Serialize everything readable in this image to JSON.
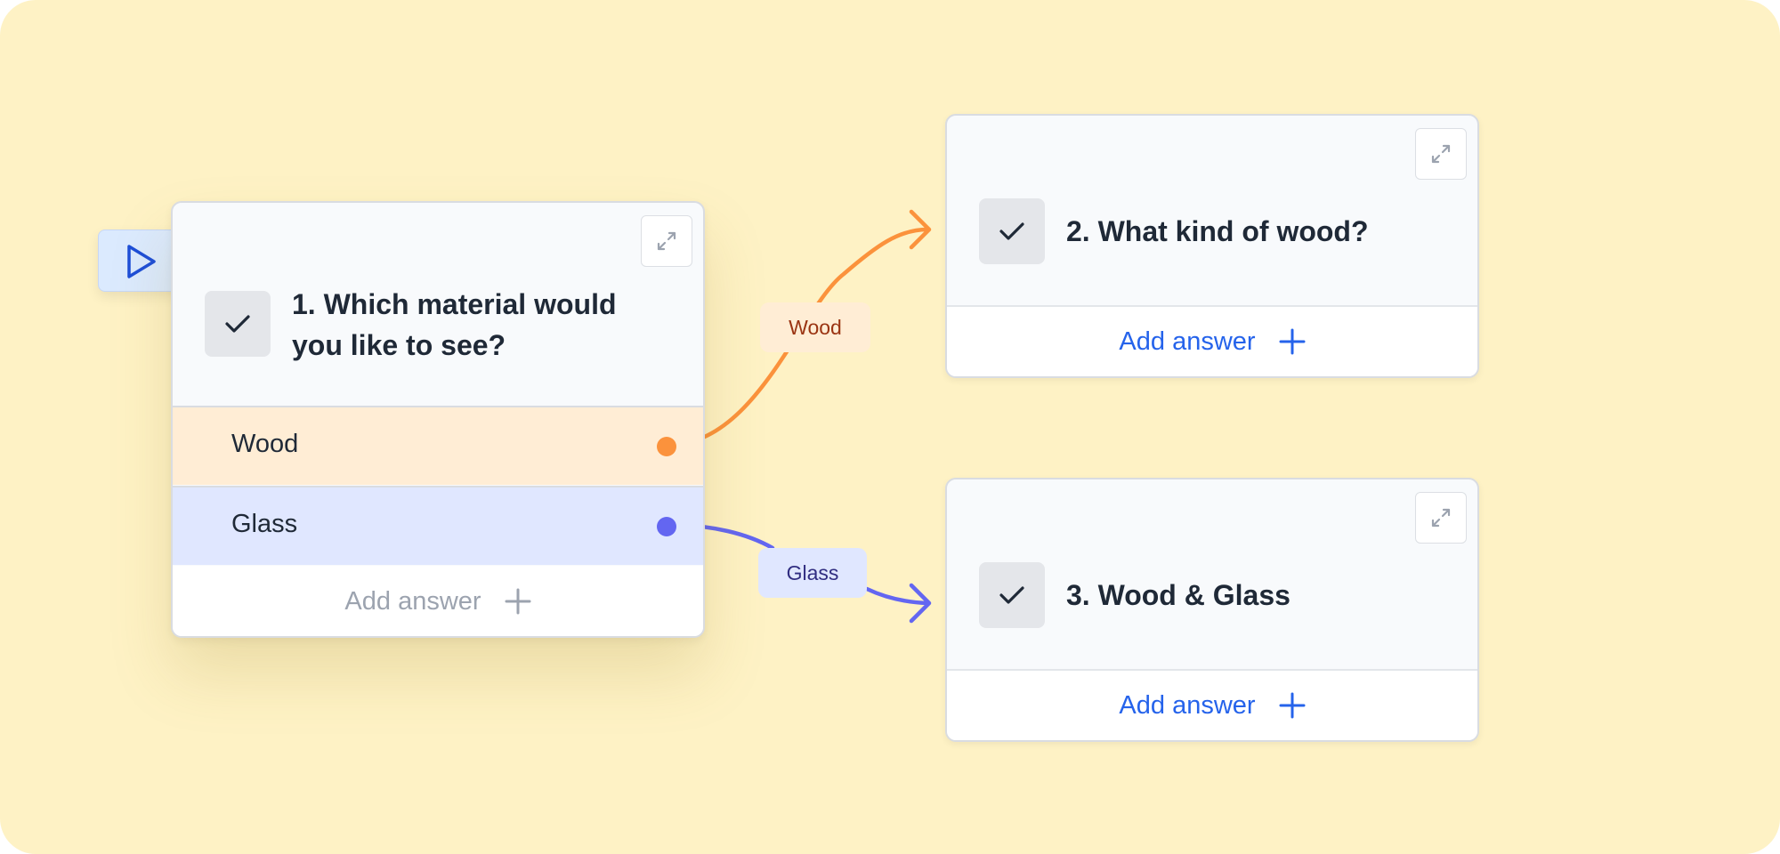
{
  "colors": {
    "background": "#fef2c5",
    "wood_path": "#fb923c",
    "glass_path": "#6366f1",
    "accent_blue": "#2563eb"
  },
  "questions": [
    {
      "title": "1. Which material would you like to see?",
      "answers": [
        "Wood",
        "Glass"
      ],
      "add_answer_label": "Add answer"
    },
    {
      "title": "2. What kind of wood?",
      "add_answer_label": "Add answer"
    },
    {
      "title": "3. Wood & Glass",
      "add_answer_label": "Add answer"
    }
  ],
  "connections": [
    {
      "label": "Wood"
    },
    {
      "label": "Glass"
    }
  ]
}
